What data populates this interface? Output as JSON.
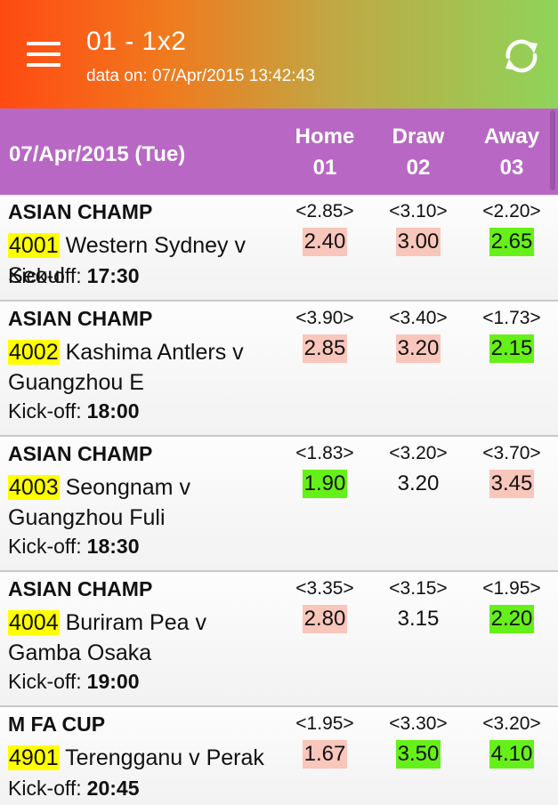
{
  "appbar": {
    "title": "01 - 1x2",
    "subtitle": "data on: 07/Apr/2015 13:42:43"
  },
  "header": {
    "date": "07/Apr/2015 (Tue)",
    "cols": [
      {
        "label": "Home",
        "code": "01"
      },
      {
        "label": "Draw",
        "code": "02"
      },
      {
        "label": "Away",
        "code": "03"
      }
    ]
  },
  "kickoff_label": "Kick-off:",
  "colors": {
    "pink": "#f8c6bb",
    "green": "#66f01a",
    "code_highlight": "#ffff00",
    "header_bg": "#b868c4"
  },
  "matches": [
    {
      "league": "ASIAN CHAMP",
      "code": "4001",
      "teams": "Western Sydney v Seoul",
      "kickoff": "17:30",
      "home": {
        "orig": "<2.85>",
        "cur": "2.40",
        "hl": "pink"
      },
      "draw": {
        "orig": "<3.10>",
        "cur": "3.00",
        "hl": "pink"
      },
      "away": {
        "orig": "<2.20>",
        "cur": "2.65",
        "hl": "green"
      }
    },
    {
      "league": "ASIAN CHAMP",
      "code": "4002",
      "teams": "Kashima Antlers v Guangzhou E",
      "kickoff": "18:00",
      "home": {
        "orig": "<3.90>",
        "cur": "2.85",
        "hl": "pink"
      },
      "draw": {
        "orig": "<3.40>",
        "cur": "3.20",
        "hl": "pink"
      },
      "away": {
        "orig": "<1.73>",
        "cur": "2.15",
        "hl": "green"
      }
    },
    {
      "league": "ASIAN CHAMP",
      "code": "4003",
      "teams": "Seongnam v Guangzhou Fuli",
      "kickoff": "18:30",
      "home": {
        "orig": "<1.83>",
        "cur": "1.90",
        "hl": "green"
      },
      "draw": {
        "orig": "<3.20>",
        "cur": "3.20",
        "hl": "none"
      },
      "away": {
        "orig": "<3.70>",
        "cur": "3.45",
        "hl": "pink"
      }
    },
    {
      "league": "ASIAN CHAMP",
      "code": "4004",
      "teams": "Buriram Pea v Gamba Osaka",
      "kickoff": "19:00",
      "home": {
        "orig": "<3.35>",
        "cur": "2.80",
        "hl": "pink"
      },
      "draw": {
        "orig": "<3.15>",
        "cur": "3.15",
        "hl": "none"
      },
      "away": {
        "orig": "<1.95>",
        "cur": "2.20",
        "hl": "green"
      }
    },
    {
      "league": "M FA CUP",
      "code": "4901",
      "teams": "Terengganu v Perak",
      "kickoff": "20:45",
      "home": {
        "orig": "<1.95>",
        "cur": "1.67",
        "hl": "pink"
      },
      "draw": {
        "orig": "<3.30>",
        "cur": "3.50",
        "hl": "green"
      },
      "away": {
        "orig": "<3.20>",
        "cur": "4.10",
        "hl": "green"
      }
    }
  ]
}
